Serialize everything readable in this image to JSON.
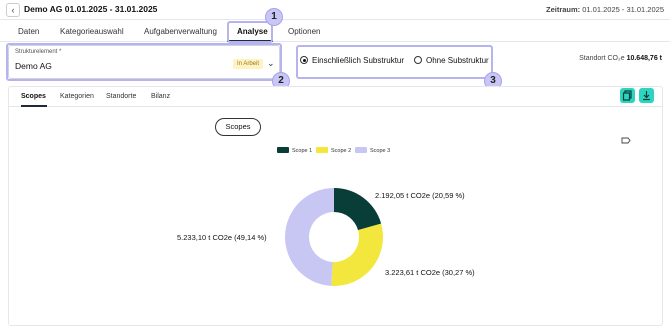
{
  "header": {
    "back_icon": "chevron-left-icon",
    "title": "Demo AG 01.01.2025 - 31.01.2025",
    "zeitraum_label": "Zeitraum:",
    "zeitraum_value": "01.01.2025 - 31.01.2025"
  },
  "tabs": [
    {
      "label": "Daten"
    },
    {
      "label": "Kategorieauswahl"
    },
    {
      "label": "Aufgabenverwaltung"
    },
    {
      "label": "Analyse"
    },
    {
      "label": "Optionen"
    }
  ],
  "active_tab": "Analyse",
  "annotations": {
    "one": "1",
    "two": "2",
    "three": "3",
    "color": "#b7b3f0"
  },
  "struktur": {
    "label": "Strukturelement *",
    "value": "Demo AG",
    "status": "In Arbeit"
  },
  "substruktur": {
    "options": [
      {
        "label": "Einschließlich Substruktur",
        "selected": true
      },
      {
        "label": "Ohne Substruktur",
        "selected": false
      }
    ]
  },
  "standort": {
    "label": "Standort CO₂e",
    "value": "10.648,76 t"
  },
  "subtabs": [
    {
      "label": "Scopes"
    },
    {
      "label": "Kategorien"
    },
    {
      "label": "Standorte"
    },
    {
      "label": "Bilanz"
    }
  ],
  "active_subtab": "Scopes",
  "actions": {
    "copy_icon": "copy-icon",
    "download_icon": "download-icon",
    "accent": "#2dd4bf"
  },
  "chart_toggle_label": "Scopes",
  "chart_data": {
    "type": "pie",
    "donut": true,
    "categories": [
      "Scope 1",
      "Scope 2",
      "Scope 3"
    ],
    "values": [
      2192.05,
      3223.61,
      5233.1
    ],
    "percentages": [
      20.59,
      30.27,
      49.14
    ],
    "colors": [
      "#083d38",
      "#f3e73e",
      "#c8c7f4"
    ],
    "data_labels": [
      "2.192,05 t  CO2e (20,59 %)",
      "3.223,61 t  CO2e (30,27 %)",
      "5.233,10 t  CO2e (49,14 %)"
    ],
    "legend_position": "top"
  }
}
